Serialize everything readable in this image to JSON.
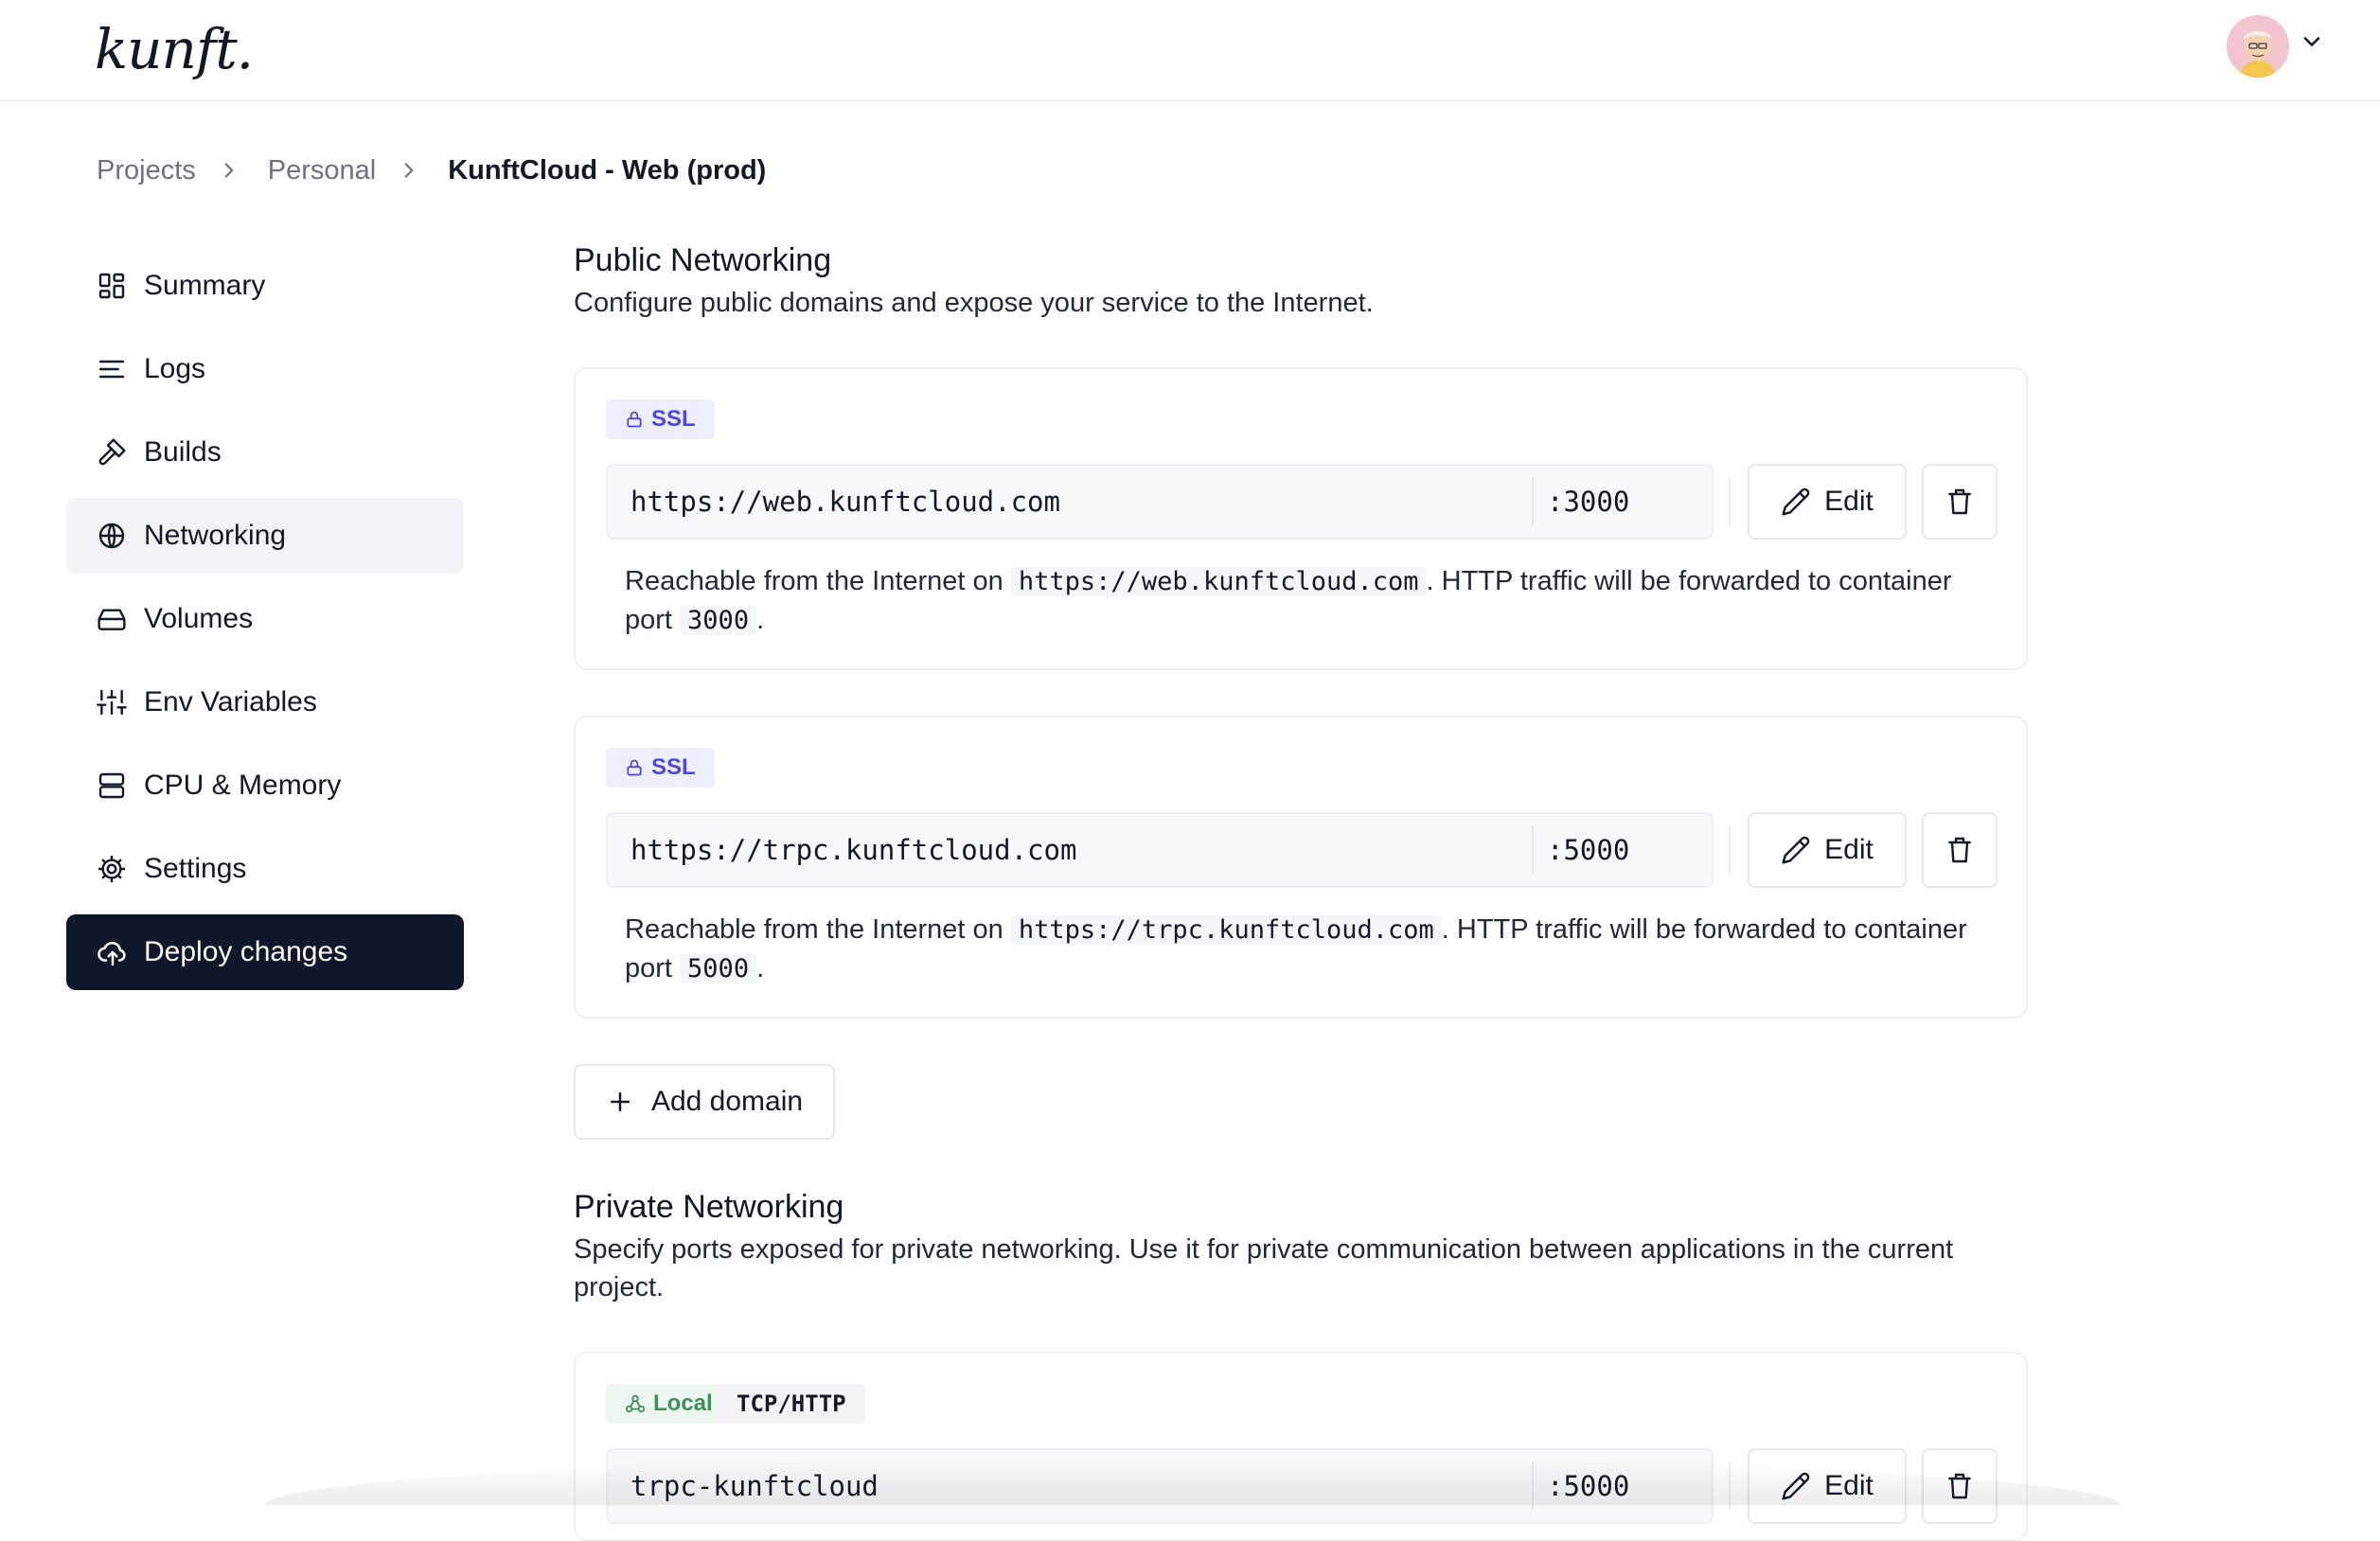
{
  "app": {
    "logo": "kunft."
  },
  "colors": {
    "accent": "#0f172a",
    "ssl_badge": "#4f46e5",
    "local_badge": "#3f8f58"
  },
  "breadcrumb": {
    "items": [
      "Projects",
      "Personal"
    ],
    "current": "KunftCloud - Web (prod)"
  },
  "sidebar": {
    "items": [
      {
        "label": "Summary",
        "icon": "dashboard-icon"
      },
      {
        "label": "Logs",
        "icon": "lines-icon"
      },
      {
        "label": "Builds",
        "icon": "hammer-icon"
      },
      {
        "label": "Networking",
        "icon": "globe-icon",
        "active": true
      },
      {
        "label": "Volumes",
        "icon": "hard-drive-icon"
      },
      {
        "label": "Env Variables",
        "icon": "sliders-icon"
      },
      {
        "label": "CPU & Memory",
        "icon": "server-icon"
      },
      {
        "label": "Settings",
        "icon": "gear-icon"
      }
    ],
    "deploy_label": "Deploy changes"
  },
  "public": {
    "title": "Public Networking",
    "description": "Configure public domains and expose your service to the Internet.",
    "domains": [
      {
        "badge": "SSL",
        "url": "https://web.kunftcloud.com",
        "port": ":3000",
        "desc_prefix": "Reachable from the Internet on",
        "desc_url": "https://web.kunftcloud.com",
        "desc_middle": ". HTTP traffic will be forwarded to container port",
        "desc_port": "3000",
        "desc_suffix": "."
      },
      {
        "badge": "SSL",
        "url": "https://trpc.kunftcloud.com",
        "port": ":5000",
        "desc_prefix": "Reachable from the Internet on",
        "desc_url": "https://trpc.kunftcloud.com",
        "desc_middle": ". HTTP traffic will be forwarded to container port",
        "desc_port": "5000",
        "desc_suffix": "."
      }
    ],
    "add_domain_label": "Add domain"
  },
  "private": {
    "title": "Private Networking",
    "description": "Specify ports exposed for private networking. Use it for private communication between applications in the current project.",
    "entries": [
      {
        "badge": "Local",
        "protocol": "TCP/HTTP",
        "host": "trpc-kunftcloud",
        "port": ":5000"
      }
    ]
  },
  "buttons": {
    "edit_label": "Edit"
  }
}
